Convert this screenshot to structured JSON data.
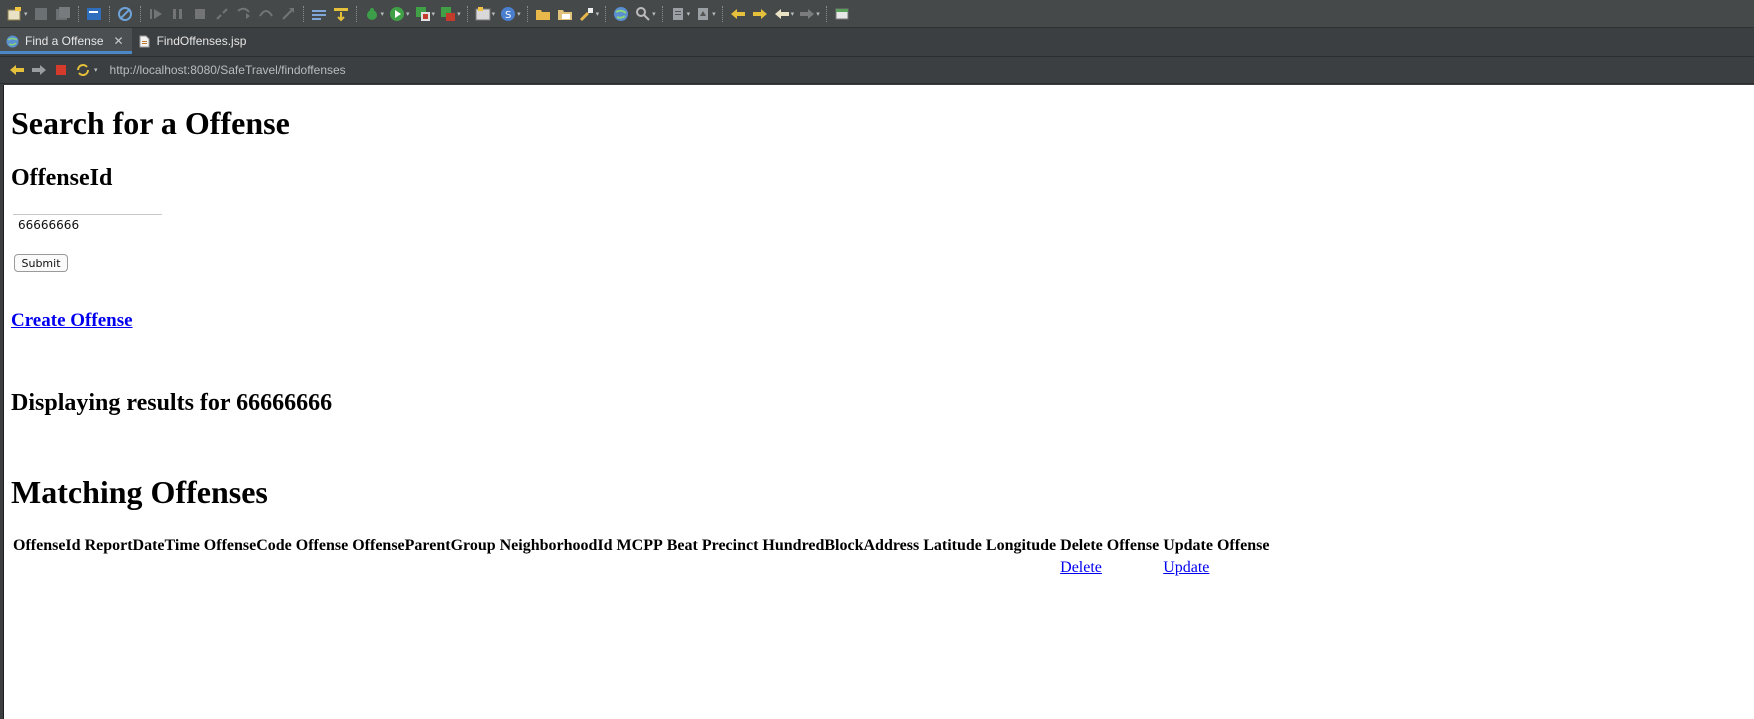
{
  "ide": {
    "toolbar_icons": [
      "new-wizard-icon",
      "save-icon",
      "save-all-icon",
      "console-icon",
      "debug-skip-icon",
      "resume-icon",
      "suspend-icon",
      "terminate-icon",
      "disconnect-icon",
      "step-into-icon",
      "step-over-icon",
      "step-return-icon",
      "task-icon",
      "drop-to-frame-icon",
      "debug-icon",
      "run-icon",
      "coverage-icon",
      "external-tools-icon",
      "new-server-icon",
      "new-servlet-icon",
      "open-folder-icon",
      "open-file-icon",
      "brush-icon",
      "web-browser-icon",
      "search-icon",
      "annotation-icon",
      "annotation-prev-icon",
      "back-edit-icon",
      "forward-edit-icon",
      "back-icon",
      "forward-icon",
      "pin-icon"
    ],
    "tabs": [
      {
        "label": "Find a Offense",
        "icon": "globe-icon",
        "active": true
      },
      {
        "label": "FindOffenses.jsp",
        "icon": "file-icon",
        "active": false
      }
    ],
    "url": "http://localhost:8080/SafeTravel/findoffenses"
  },
  "page": {
    "title": "Search for a Offense",
    "field_label": "OffenseId",
    "field_value": "66666666",
    "submit_label": "Submit",
    "create_link": "Create Offense",
    "results_heading": "Displaying results for 66666666",
    "matching_heading": "Matching Offenses",
    "table": {
      "headers": [
        "OffenseId",
        "ReportDateTime",
        "OffenseCode",
        "Offense",
        "OffenseParentGroup",
        "NeighborhoodId",
        "MCPP",
        "Beat",
        "Precinct",
        "HundredBlockAddress",
        "Latitude",
        "Longitude",
        "Delete Offense",
        "Update Offense"
      ],
      "row_links": {
        "delete": "Delete",
        "update": "Update"
      }
    }
  }
}
